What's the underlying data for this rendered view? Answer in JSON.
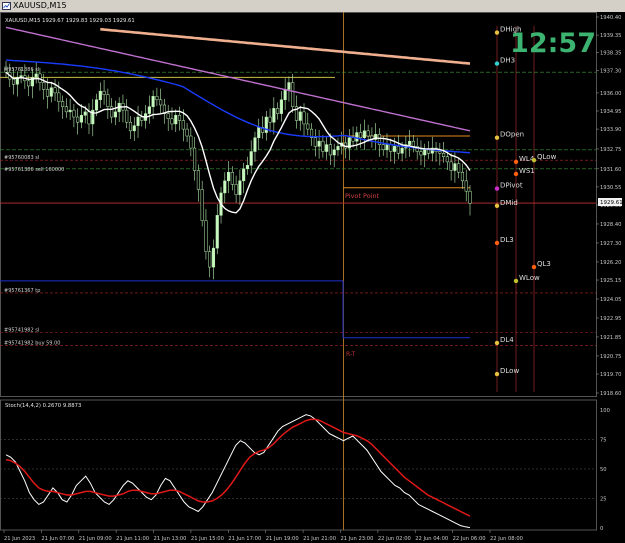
{
  "window": {
    "title": "XAUUSD,M15"
  },
  "main": {
    "header": "XAUUSD,M15 1929.67 1929.83 1929.03 1929.61",
    "clock": "12:57",
    "current_price": "1929.61",
    "pivot_label": "Pivot Point",
    "rt_label": "R-T"
  },
  "orders": [
    {
      "text": "#95761386 sell 160000",
      "price": 1931.4,
      "color": "#2e8b57"
    },
    {
      "text": "#95760083 sl",
      "price": 1932.1,
      "color": "#c03030"
    },
    {
      "text": "#95761367 tp",
      "price": 1924.4,
      "color": "#c03030"
    },
    {
      "text": "#95741982 sl",
      "price": 1922.1,
      "color": "#c03030"
    },
    {
      "text": "#95741982 buy 59.00",
      "price": 1921.35,
      "color": "#2e8b57"
    },
    {
      "text": "#95761386 sl",
      "price": 1937.2,
      "color": "#c03030"
    }
  ],
  "levels": [
    {
      "name": "DHigh",
      "price": 1939.5,
      "dot": "#e8c040"
    },
    {
      "name": "DH3",
      "price": 1937.7,
      "dot": "#30d0d0"
    },
    {
      "name": "DOpen",
      "price": 1933.4,
      "dot": "#e8c040"
    },
    {
      "name": "WL4",
      "price": 1932.0,
      "dot": "#ff6010"
    },
    {
      "name": "QLow",
      "price": 1932.1,
      "dot": "#c0c030"
    },
    {
      "name": "WS1",
      "price": 1931.3,
      "dot": "#ff6010"
    },
    {
      "name": "DPivot",
      "price": 1930.45,
      "dot": "#cc30cc"
    },
    {
      "name": "DMid",
      "price": 1929.45,
      "dot": "#e8c040"
    },
    {
      "name": "DL3",
      "price": 1927.3,
      "dot": "#ff6010"
    },
    {
      "name": "QL3",
      "price": 1925.9,
      "dot": "#ff6010"
    },
    {
      "name": "WLow",
      "price": 1925.1,
      "dot": "#c0c030"
    },
    {
      "name": "DL4",
      "price": 1921.5,
      "dot": "#e8c040"
    },
    {
      "name": "DLow",
      "price": 1919.7,
      "dot": "#e8c040"
    }
  ],
  "stoch": {
    "label": "Stoch(14,4,2) 0.2670 9.8873"
  },
  "chart_data": [
    {
      "type": "candlestick",
      "title": "XAUUSD,M15",
      "ylim": [
        1918.6,
        1940.4
      ],
      "y_ticks": [
        "1940.40",
        "1939.35",
        "1938.35",
        "1937.30",
        "1936.00",
        "1934.95",
        "1933.90",
        "1932.75",
        "1931.60",
        "1930.55",
        "1929.50",
        "1928.40",
        "1927.30",
        "1926.20",
        "1925.15",
        "1924.05",
        "1922.95",
        "1921.85",
        "1920.75",
        "1919.70",
        "1918.60"
      ],
      "x_ticks": [
        "21 Jun 2023",
        "21 Jun 07:00",
        "21 Jun 09:00",
        "21 Jun 11:00",
        "21 Jun 13:00",
        "21 Jun 15:00",
        "21 Jun 17:00",
        "21 Jun 19:00",
        "21 Jun 21:00",
        "21 Jun 23:00",
        "22 Jun 02:00",
        "22 Jun 04:00",
        "22 Jun 06:00",
        "22 Jun 08:00"
      ],
      "close": [
        1937.2,
        1936.8,
        1936.5,
        1936.9,
        1937.0,
        1936.7,
        1936.4,
        1936.9,
        1937.1,
        1936.6,
        1936.2,
        1935.8,
        1936.3,
        1936.0,
        1935.5,
        1935.2,
        1934.9,
        1935.0,
        1934.6,
        1934.3,
        1934.7,
        1934.9,
        1934.2,
        1935.0,
        1935.6,
        1936.1,
        1935.9,
        1935.2,
        1934.6,
        1934.9,
        1935.4,
        1935.0,
        1934.3,
        1933.8,
        1934.1,
        1934.6,
        1934.4,
        1934.8,
        1935.2,
        1935.8,
        1935.6,
        1935.3,
        1934.8,
        1934.5,
        1934.2,
        1934.7,
        1934.4,
        1933.9,
        1933.5,
        1932.8,
        1931.5,
        1930.4,
        1928.6,
        1926.8,
        1925.9,
        1927.0,
        1928.9,
        1930.2,
        1930.9,
        1931.4,
        1930.7,
        1930.1,
        1930.9,
        1931.6,
        1931.8,
        1932.6,
        1933.4,
        1934.0,
        1933.7,
        1934.6,
        1934.3,
        1935.1,
        1934.8,
        1935.6,
        1936.2,
        1936.6,
        1935.2,
        1934.4,
        1934.9,
        1934.2,
        1933.9,
        1933.4,
        1932.9,
        1933.2,
        1932.6,
        1933.0,
        1932.4,
        1932.7,
        1932.9,
        1933.1,
        1932.8,
        1933.4,
        1933.2,
        1933.7,
        1933.4,
        1933.8,
        1933.5,
        1933.3,
        1933.6,
        1933.0,
        1932.7,
        1933.0,
        1932.6,
        1932.9,
        1932.5,
        1932.8,
        1933.0,
        1933.2,
        1932.9,
        1932.6,
        1932.4,
        1932.7,
        1932.5,
        1932.8,
        1932.6,
        1932.5,
        1932.3,
        1932.0,
        1931.5,
        1931.9,
        1931.4,
        1930.9,
        1930.3,
        1929.6
      ],
      "series": [
        {
          "name": "MA blue",
          "color": "#1a3cff",
          "from": 1937.9,
          "to": 1932.7
        },
        {
          "name": "MA white",
          "color": "#ffffff"
        },
        {
          "name": "MA violet",
          "color": "#c070d0",
          "from": 1939.8,
          "to": 1933.8
        },
        {
          "name": "MA salmon",
          "color": "#f0b090",
          "from": 1940.2,
          "to": 1937.7
        }
      ]
    },
    {
      "type": "line",
      "title": "Stoch(14,4,2) 0.2670 9.8873",
      "ylim": [
        0,
        100
      ],
      "y_ticks": [
        "100",
        "75",
        "50",
        "25",
        "0"
      ],
      "series": [
        {
          "name": "Main",
          "color": "#ffffff",
          "values": [
            62,
            60,
            56,
            48,
            40,
            30,
            24,
            20,
            22,
            28,
            34,
            30,
            24,
            22,
            28,
            36,
            40,
            44,
            38,
            30,
            26,
            22,
            20,
            24,
            30,
            36,
            40,
            38,
            34,
            30,
            26,
            24,
            28,
            36,
            42,
            40,
            34,
            28,
            22,
            18,
            16,
            14,
            18,
            24,
            30,
            38,
            46,
            54,
            62,
            70,
            74,
            72,
            68,
            64,
            62,
            64,
            70,
            76,
            82,
            86,
            88,
            90,
            92,
            94,
            96,
            95,
            92,
            88,
            84,
            80,
            78,
            76,
            74,
            76,
            78,
            74,
            70,
            66,
            60,
            54,
            48,
            44,
            40,
            36,
            34,
            30,
            28,
            24,
            20,
            18,
            16,
            14,
            12,
            10,
            8,
            6,
            4,
            2,
            1,
            0.3
          ]
        },
        {
          "name": "Signal",
          "color": "#e01818",
          "values": [
            58,
            57,
            55,
            52,
            48,
            43,
            38,
            34,
            32,
            31,
            31,
            30,
            29,
            28,
            28,
            29,
            30,
            31,
            31,
            30,
            29,
            28,
            27,
            27,
            28,
            29,
            31,
            32,
            32,
            31,
            30,
            29,
            29,
            30,
            31,
            32,
            32,
            31,
            29,
            27,
            25,
            23,
            22,
            22,
            23,
            25,
            28,
            32,
            37,
            43,
            49,
            55,
            60,
            63,
            65,
            66,
            68,
            71,
            75,
            79,
            82,
            85,
            87,
            89,
            91,
            92,
            92,
            91,
            89,
            87,
            85,
            83,
            81,
            80,
            79,
            78,
            76,
            74,
            71,
            67,
            63,
            59,
            55,
            51,
            47,
            43,
            40,
            37,
            34,
            31,
            28,
            26,
            24,
            22,
            20,
            18,
            16,
            14,
            12,
            10
          ]
        }
      ]
    }
  ]
}
